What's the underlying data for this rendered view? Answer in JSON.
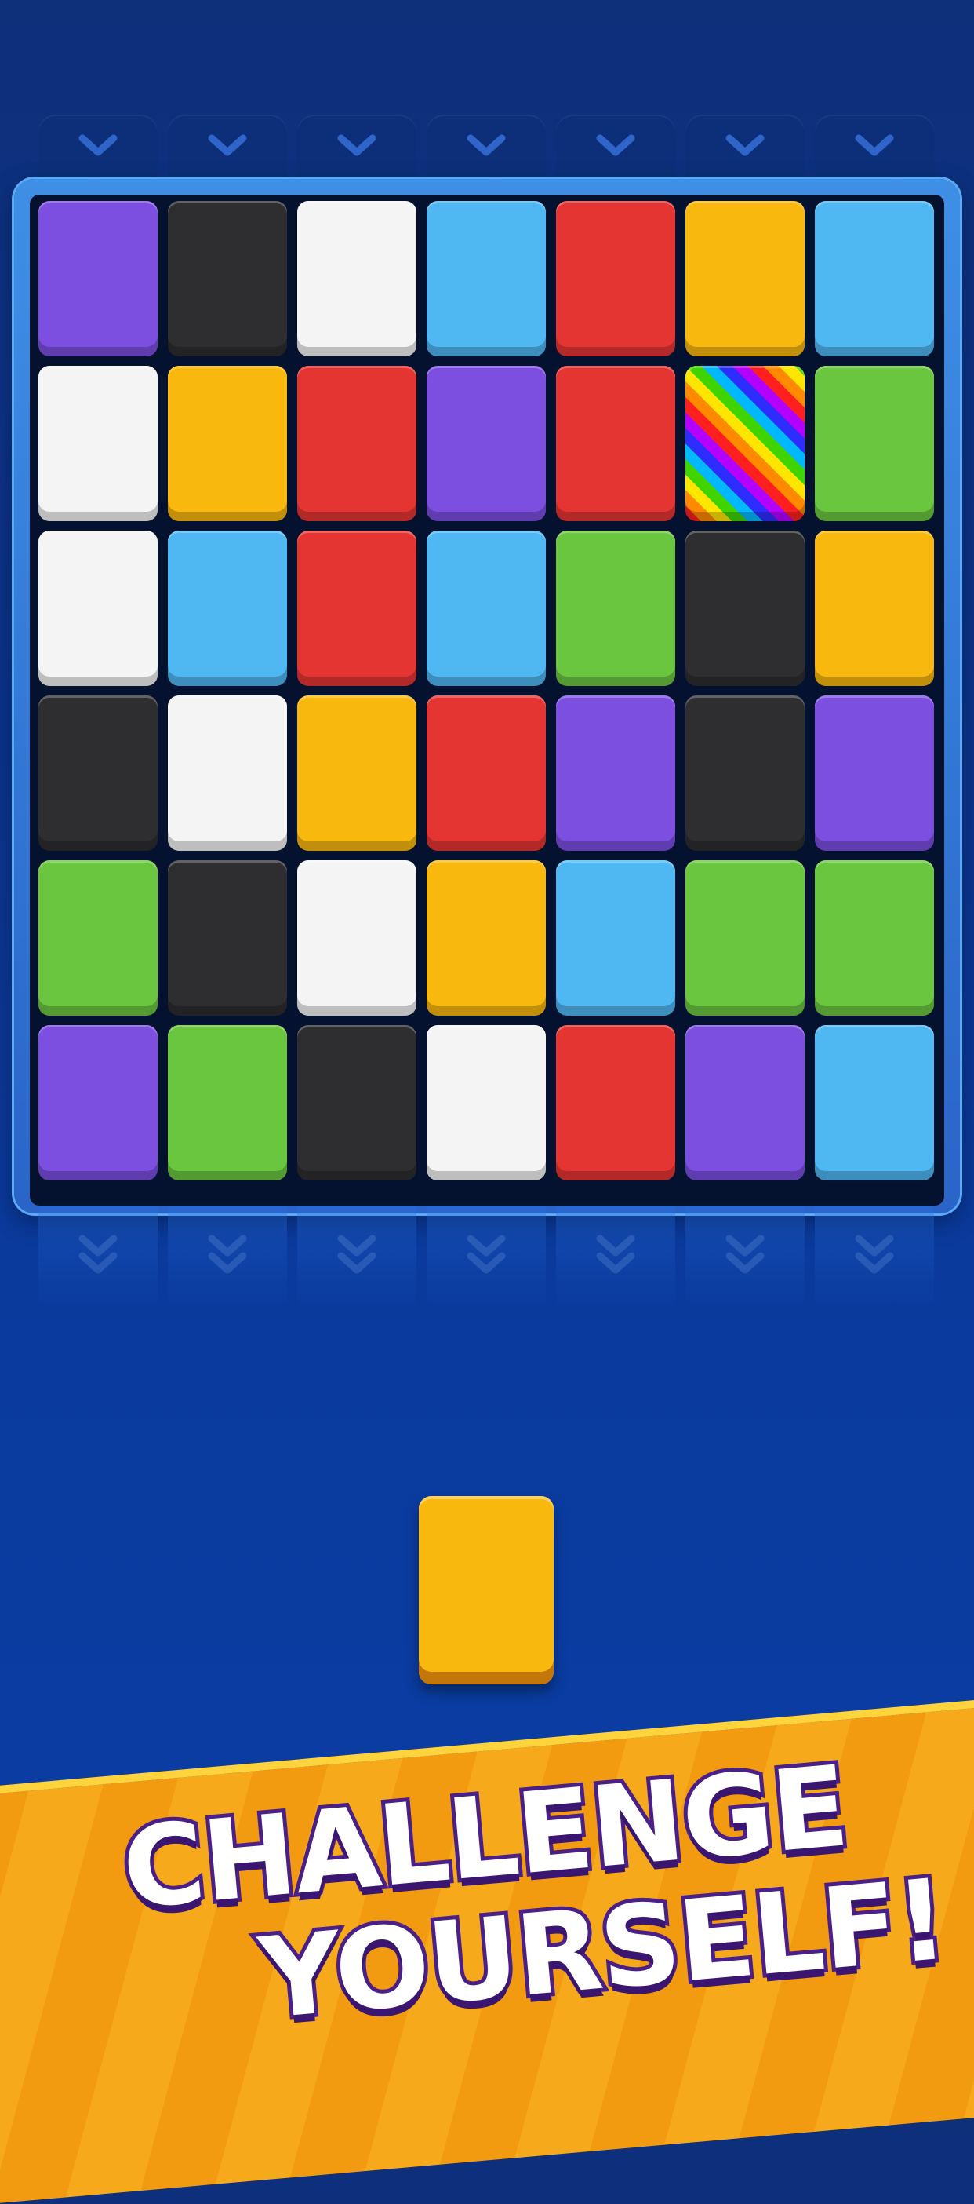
{
  "board": {
    "columns": 7,
    "rows": 6,
    "grid": [
      [
        "purple",
        "black",
        "white",
        "blue",
        "red",
        "yellow",
        "blue"
      ],
      [
        "white",
        "yellow",
        "red",
        "purple",
        "red",
        "rainbow",
        "green"
      ],
      [
        "white",
        "blue",
        "red",
        "blue",
        "green",
        "black",
        "yellow"
      ],
      [
        "black",
        "white",
        "yellow",
        "red",
        "purple",
        "black",
        "purple"
      ],
      [
        "green",
        "black",
        "white",
        "yellow",
        "blue",
        "green",
        "green"
      ],
      [
        "purple",
        "green",
        "black",
        "white",
        "red",
        "purple",
        "blue"
      ]
    ]
  },
  "colors": {
    "purple": "#7c4fe0",
    "black": "#2e2e30",
    "white": "#f4f4f4",
    "blue": "#4fb7f2",
    "red": "#e53532",
    "yellow": "#f8b80e",
    "green": "#6ac63f",
    "board_bg": "#05122f",
    "banner_orange": "#f29a10",
    "text_outline": "#4b1f88"
  },
  "column_tabs": [
    "chevron-down-icon",
    "chevron-down-icon",
    "chevron-down-icon",
    "chevron-down-icon",
    "chevron-down-icon",
    "chevron-down-icon",
    "chevron-down-icon"
  ],
  "next_tile": {
    "color": "yellow"
  },
  "banner": {
    "line1": "CHALLENGE",
    "line2": "YOURSELF!"
  }
}
